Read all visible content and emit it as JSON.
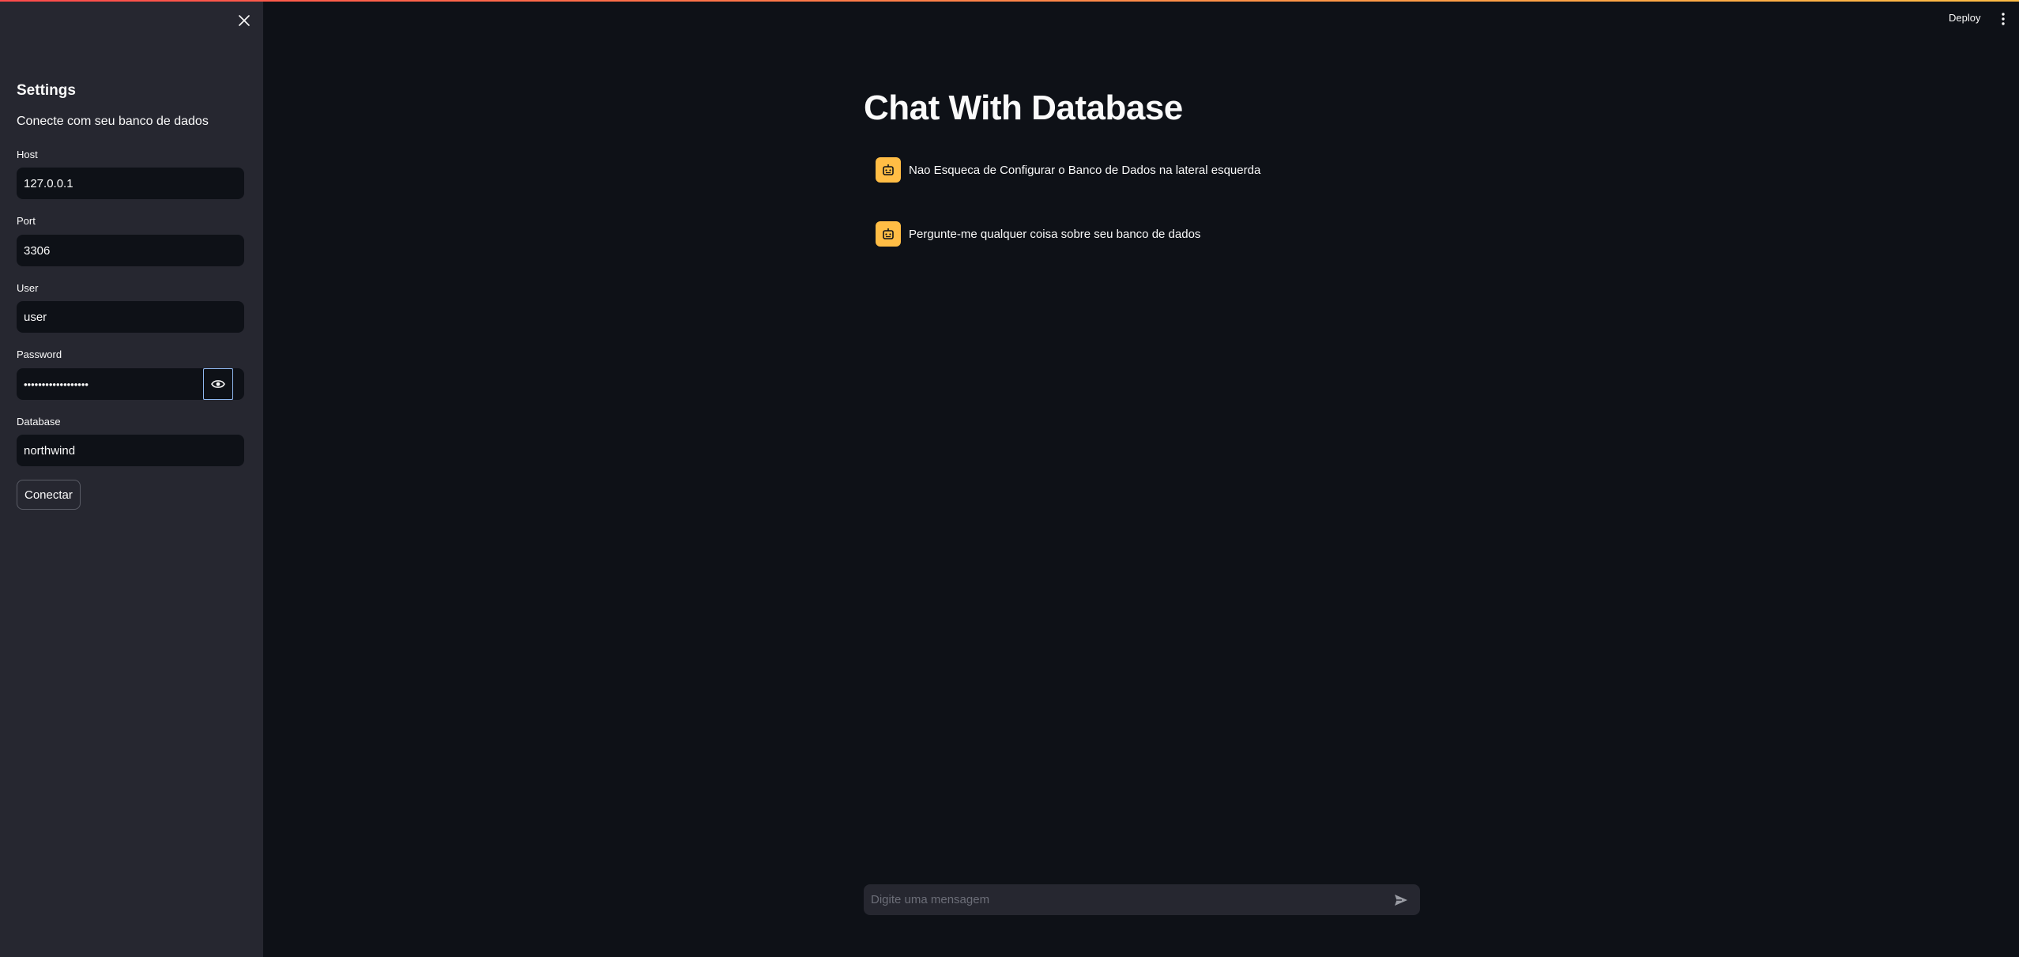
{
  "sidebar": {
    "title": "Settings",
    "subtitle": "Conecte com seu banco de dados",
    "fields": [
      {
        "label": "Host",
        "value": "127.0.0.1"
      },
      {
        "label": "Port",
        "value": "3306"
      },
      {
        "label": "User",
        "value": "user"
      },
      {
        "label": "Password",
        "value": "••••••••••••••••••"
      },
      {
        "label": "Database",
        "value": "northwind"
      }
    ],
    "connect_label": "Conectar"
  },
  "header": {
    "deploy_label": "Deploy"
  },
  "main": {
    "title": "Chat With Database",
    "messages": [
      {
        "text": "Nao Esqueca de Configurar o Banco de Dados na lateral esquerda"
      },
      {
        "text": "Pergunte-me qualquer coisa sobre seu banco de dados"
      }
    ],
    "chat_input": {
      "placeholder": "Digite uma mensagem"
    }
  },
  "icons": {
    "close": "close-icon",
    "eye": "eye-icon",
    "menu": "kebab-menu-icon",
    "bot": "robot-icon",
    "send": "send-icon"
  },
  "colors": {
    "app_background": "#0e1117",
    "sidebar_background": "#262730",
    "avatar_accent": "#ffbd45",
    "focus_ring": "#8fb8f0"
  }
}
